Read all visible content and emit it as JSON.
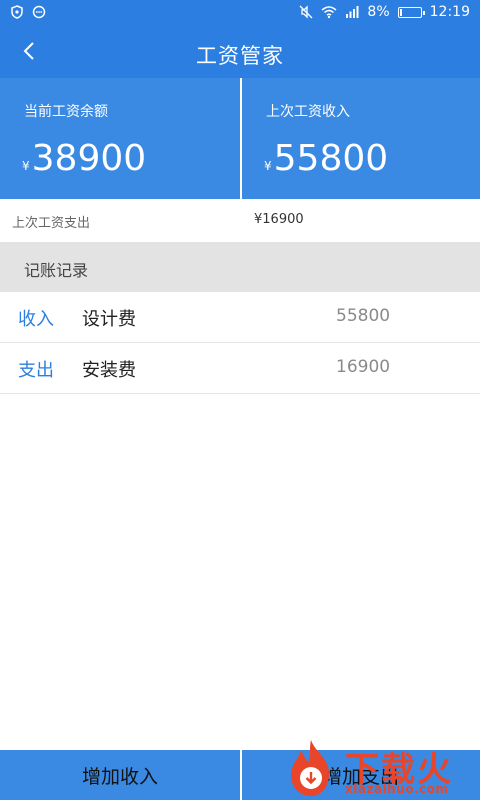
{
  "status_bar": {
    "battery": "8%",
    "time": "12:19"
  },
  "app_bar": {
    "title": "工资管家"
  },
  "cards": {
    "balance": {
      "label": "当前工资余额",
      "currency": "¥",
      "amount": "38900"
    },
    "last_income": {
      "label": "上次工资收入",
      "currency": "¥",
      "amount": "55800"
    }
  },
  "last_expense": {
    "label": "上次工资支出",
    "value": "¥16900"
  },
  "records_section": {
    "title": "记账记录",
    "items": [
      {
        "type": "收入",
        "name": "设计费",
        "amount": "55800"
      },
      {
        "type": "支出",
        "name": "安装费",
        "amount": "16900"
      }
    ]
  },
  "buttons": {
    "add_income": "增加收入",
    "add_expense": "增加支出"
  },
  "watermark": {
    "text": "下载火",
    "sub": "xiazaihuo.com"
  },
  "colors": {
    "primary": "#2c7fe0",
    "card": "#3a8ae3",
    "section_bg": "#e3e3e3",
    "watermark": "#e8452a"
  }
}
